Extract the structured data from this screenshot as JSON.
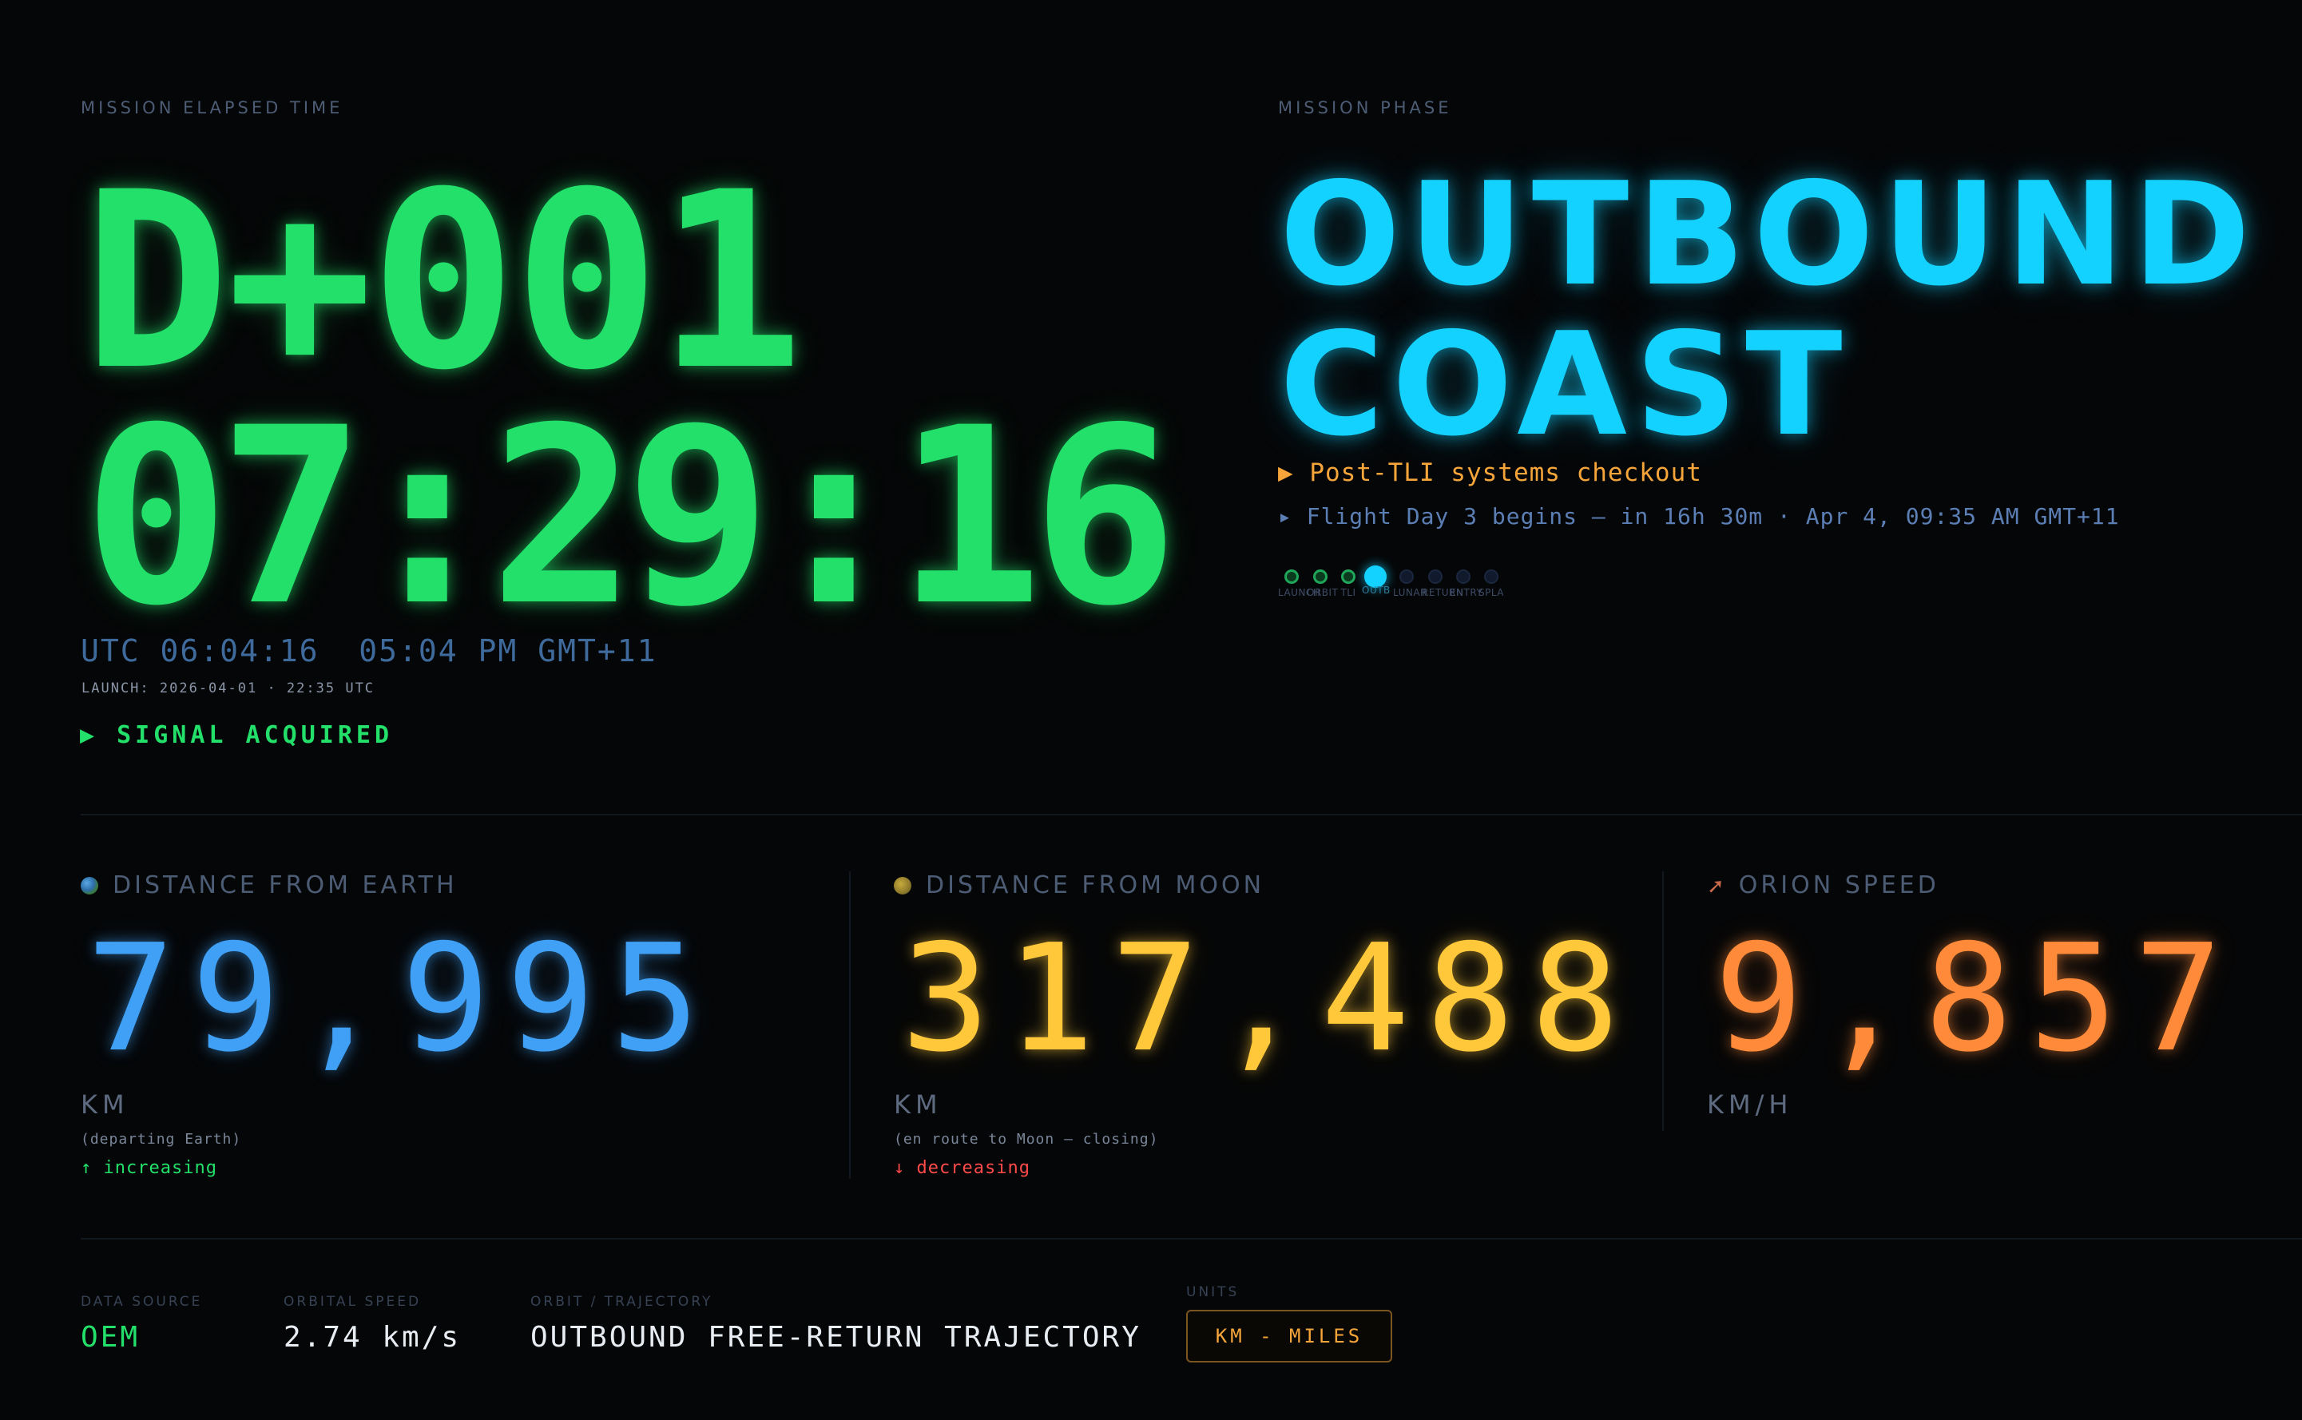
{
  "met": {
    "label": "MISSION ELAPSED TIME",
    "day": "D+001",
    "clock": "07:29:16",
    "utc_line": "UTC 06:04:16  05:04 PM GMT+11",
    "launch_line": "LAUNCH: 2026-04-01 · 22:35 UTC",
    "signal": "▶ SIGNAL ACQUIRED"
  },
  "phase": {
    "label": "MISSION PHASE",
    "line1": "OUTBOUND",
    "line2": "COAST",
    "activity": "▶ Post-TLI systems checkout",
    "next": "▸ Flight Day 3 begins — in 16h 30m · Apr 4, 09:35 AM GMT+11",
    "timeline": [
      {
        "label": "LAUNCH",
        "state": "done"
      },
      {
        "label": "ORBIT",
        "state": "done"
      },
      {
        "label": "TLI",
        "state": "done"
      },
      {
        "label": "OUTB",
        "state": "current"
      },
      {
        "label": "LUNAR",
        "state": "future"
      },
      {
        "label": "RETURN",
        "state": "future"
      },
      {
        "label": "ENTRY",
        "state": "future"
      },
      {
        "label": "SPLA",
        "state": "future"
      }
    ]
  },
  "stats": {
    "earth": {
      "label": "DISTANCE FROM EARTH",
      "icon": "earth-icon",
      "value": "79,995",
      "unit": "KM",
      "note": "(departing Earth)",
      "trend": "↑ increasing",
      "color": "#3fa0f5",
      "trend_color": "#22e06a"
    },
    "moon": {
      "label": "DISTANCE FROM MOON",
      "icon": "moon-icon",
      "value": "317,488",
      "unit": "KM",
      "note": "(en route to Moon — closing)",
      "trend": "↓ decreasing",
      "color": "#ffc83a",
      "trend_color": "#ff4a4a"
    },
    "speed": {
      "label": "ORION SPEED",
      "icon": "rocket-icon",
      "value": "9,857",
      "unit": "KM/H",
      "color": "#ff8a3a"
    }
  },
  "footer": {
    "data_source": {
      "label": "DATA SOURCE",
      "value": "OEM",
      "color": "#22e06a"
    },
    "orbital_speed": {
      "label": "ORBITAL SPEED",
      "value": "2.74 km/s"
    },
    "trajectory": {
      "label": "ORBIT / TRAJECTORY",
      "value": "OUTBOUND FREE-RETURN TRAJECTORY"
    },
    "units": {
      "label": "UNITS",
      "toggle": "KM - MILES"
    }
  }
}
